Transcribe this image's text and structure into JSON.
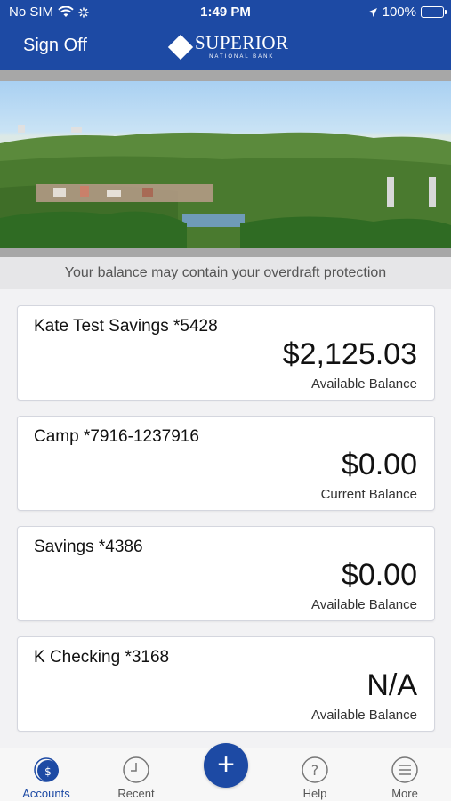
{
  "status_bar": {
    "carrier": "No SIM",
    "time": "1:49 PM",
    "battery": "100%"
  },
  "header": {
    "sign_off": "Sign Off",
    "logo_name": "SUPERIOR",
    "logo_sub": "NATIONAL BANK"
  },
  "notice": "Your balance may contain your overdraft protection",
  "accounts": [
    {
      "name": "Kate Test Savings *5428",
      "amount": "$2,125.03",
      "label": "Available Balance"
    },
    {
      "name": "Camp *7916-1237916",
      "amount": "$0.00",
      "label": "Current Balance"
    },
    {
      "name": "Savings *4386",
      "amount": "$0.00",
      "label": "Available Balance"
    },
    {
      "name": "K Checking *3168",
      "amount": "N/A",
      "label": "Available Balance"
    }
  ],
  "nav": {
    "accounts": "Accounts",
    "recent": "Recent",
    "add": "+",
    "help": "Help",
    "more": "More"
  },
  "colors": {
    "brand": "#1d4aa4",
    "background": "#f2f2f4"
  }
}
